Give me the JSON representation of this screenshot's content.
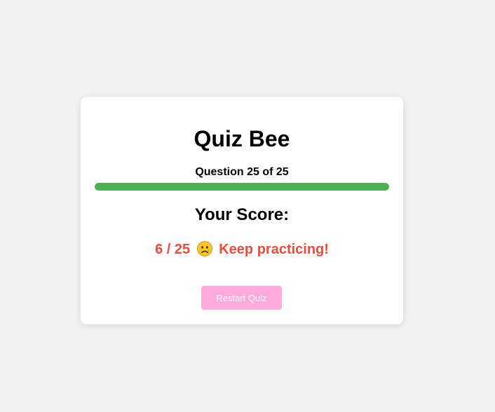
{
  "quiz": {
    "title": "Quiz Bee",
    "progress_text": "Question 25 of 25",
    "progress_fraction": 1.0,
    "score_heading": "Your Score:",
    "score_value": "6 / 25",
    "feedback_emoji": "sad-face-icon",
    "feedback_text": "Keep practicing!",
    "restart_label": "Restart Quiz"
  },
  "colors": {
    "background": "#f2f2f2",
    "card": "#ffffff",
    "progress_fill": "#4caf50",
    "score_text": "#e74c3c",
    "restart_button": "#ffaadd"
  }
}
